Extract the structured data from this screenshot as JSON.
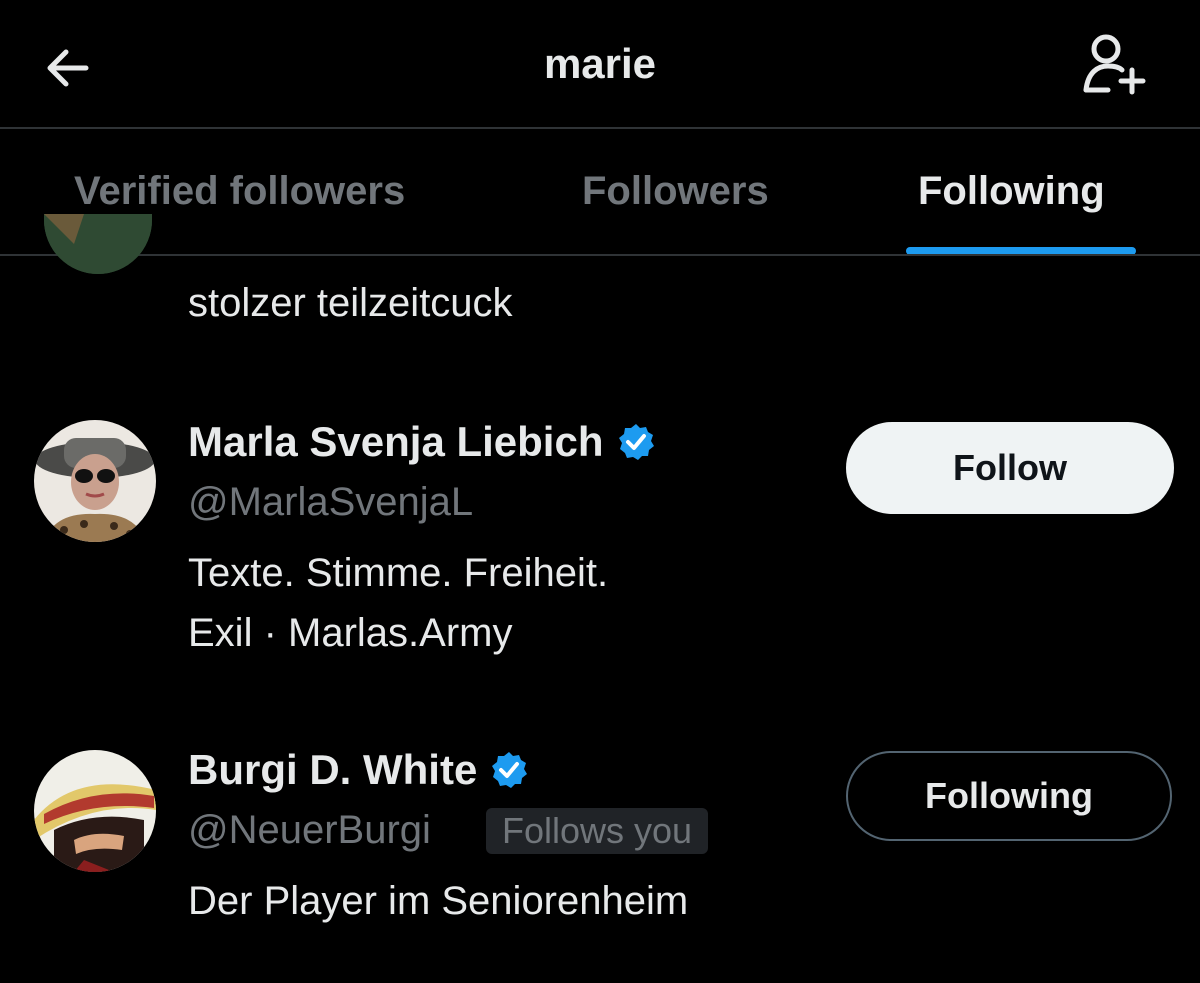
{
  "header": {
    "title": "marie",
    "back_icon": "arrow-left-icon",
    "add_icon": "person-add-icon"
  },
  "tabs": [
    {
      "label": "Verified followers",
      "active": false
    },
    {
      "label": "Followers",
      "active": false
    },
    {
      "label": "Following",
      "active": true
    }
  ],
  "colors": {
    "background": "#000000",
    "accent": "#1d9bf0",
    "text": "#e7e9ea",
    "muted": "#71767b"
  },
  "users": [
    {
      "bio": "stolzer teilzeitcuck"
    },
    {
      "name": "Marla Svenja Liebich",
      "verified": true,
      "handle": "@MarlaSvenjaL",
      "bio_line1": "Texte. Stimme. Freiheit.",
      "bio_line2": "Exil · Marlas.Army",
      "button": "Follow"
    },
    {
      "name": "Burgi D. White",
      "verified": true,
      "handle": "@NeuerBurgi",
      "badge": "Follows you",
      "bio": "Der Player im Seniorenheim",
      "button": "Following"
    }
  ]
}
